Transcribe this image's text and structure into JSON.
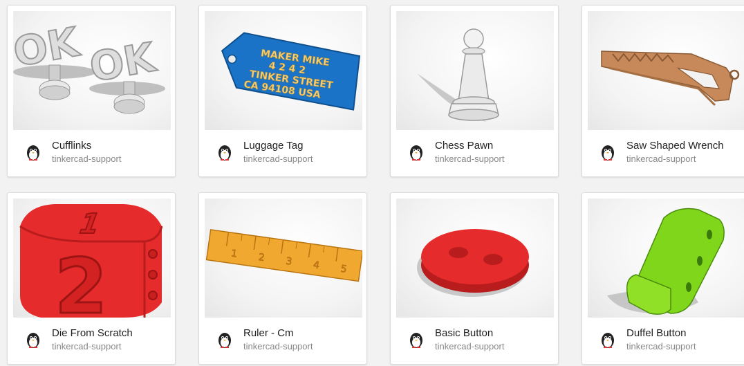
{
  "cards": [
    {
      "title": "Cufflinks",
      "author": "tinkercad-support",
      "thumb_icon": "cufflinks-model-icon"
    },
    {
      "title": "Luggage Tag",
      "author": "tinkercad-support",
      "thumb_icon": "luggage-tag-model-icon",
      "model_text": [
        "MAKER MIKE",
        "4 2 4 2",
        "TINKER STREET",
        "CA 94108 USA"
      ]
    },
    {
      "title": "Chess Pawn",
      "author": "tinkercad-support",
      "thumb_icon": "chess-pawn-model-icon"
    },
    {
      "title": "Saw Shaped Wrench",
      "author": "tinkercad-support",
      "thumb_icon": "wrench-model-icon"
    },
    {
      "title": "Die From Scratch",
      "author": "tinkercad-support",
      "thumb_icon": "die-model-icon"
    },
    {
      "title": "Ruler - Cm",
      "author": "tinkercad-support",
      "thumb_icon": "ruler-model-icon",
      "model_text": [
        "1",
        "2",
        "3",
        "4",
        "5"
      ]
    },
    {
      "title": "Basic Button",
      "author": "tinkercad-support",
      "thumb_icon": "button-model-icon"
    },
    {
      "title": "Duffel Button",
      "author": "tinkercad-support",
      "thumb_icon": "duffel-button-model-icon"
    }
  ],
  "avatar_icon": "penguin-avatar-icon",
  "colors": {
    "background": "#f2f2f2",
    "card": "#ffffff",
    "title": "#222222",
    "author": "#888888",
    "luggage_tag": "#1a73c6",
    "wrench": "#c8895a",
    "die": "#e52b2b",
    "ruler": "#f0a830",
    "basic_button": "#e52b2b",
    "duffel_button": "#7fd61b",
    "cufflinks": "#dedede"
  }
}
